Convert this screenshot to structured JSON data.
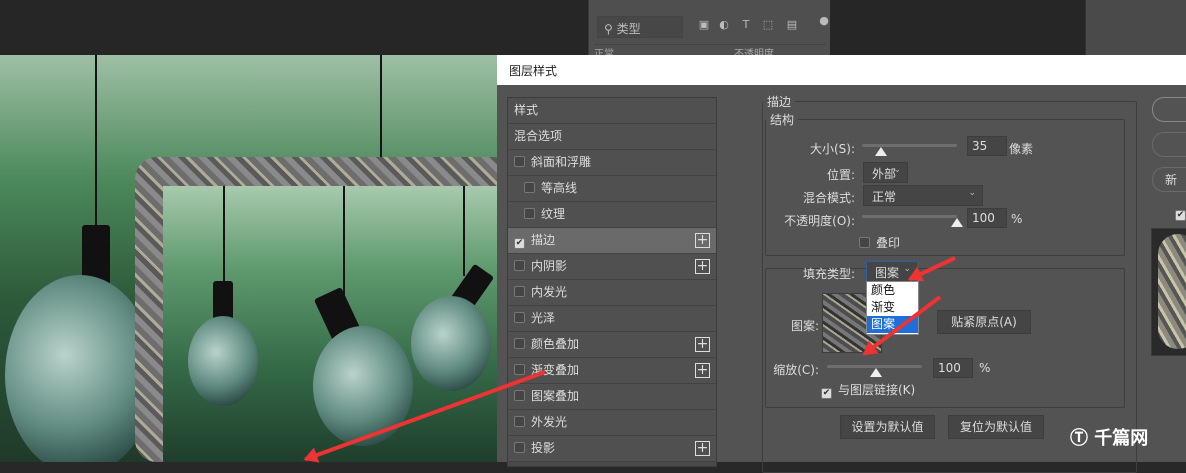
{
  "layers_panel": {
    "search_placeholder": "类型",
    "filter_icons": [
      "image-filter-icon",
      "adjustment-filter-icon",
      "type-filter-icon",
      "shape-filter-icon",
      "smart-object-filter-icon"
    ],
    "blend_mode": "正常",
    "opacity_label": "不透明度"
  },
  "dialog": {
    "title": "图层样式",
    "styles": [
      {
        "label": "样式",
        "checkbox": false
      },
      {
        "label": "混合选项",
        "checkbox": false
      },
      {
        "label": "斜面和浮雕",
        "checkbox": true,
        "checked": false
      },
      {
        "label": "等高线",
        "checkbox": true,
        "checked": false,
        "indent": true
      },
      {
        "label": "纹理",
        "checkbox": true,
        "checked": false,
        "indent": true
      },
      {
        "label": "描边",
        "checkbox": true,
        "checked": true,
        "plus": true,
        "active": true
      },
      {
        "label": "内阴影",
        "checkbox": true,
        "checked": false,
        "plus": true
      },
      {
        "label": "内发光",
        "checkbox": true,
        "checked": false
      },
      {
        "label": "光泽",
        "checkbox": true,
        "checked": false
      },
      {
        "label": "颜色叠加",
        "checkbox": true,
        "checked": false,
        "plus": true
      },
      {
        "label": "渐变叠加",
        "checkbox": true,
        "checked": false,
        "plus": true
      },
      {
        "label": "图案叠加",
        "checkbox": true,
        "checked": false
      },
      {
        "label": "外发光",
        "checkbox": true,
        "checked": false
      },
      {
        "label": "投影",
        "checkbox": true,
        "checked": false,
        "plus": true
      }
    ],
    "stroke": {
      "section_title": "描边",
      "structure_title": "结构",
      "size_label": "大小(S):",
      "size_value": "35",
      "size_unit": "像素",
      "size_slider_fraction": 0.2,
      "position_label": "位置:",
      "position_value": "外部",
      "blend_label": "混合模式:",
      "blend_value": "正常",
      "opacity_label": "不透明度(O):",
      "opacity_value": "100",
      "opacity_unit": "%",
      "overprint_label": "叠印",
      "overprint_checked": false,
      "fill_type_label": "填充类型:",
      "fill_type_value": "图案",
      "fill_type_options": [
        "颜色",
        "渐变",
        "图案"
      ],
      "pattern_label": "图案:",
      "snap_origin_button": "贴紧原点(A)",
      "scale_label": "缩放(C):",
      "scale_value": "100",
      "scale_unit": "%",
      "link_label": "与图层链接(K)",
      "link_checked": true,
      "set_default_button": "设置为默认值",
      "reset_default_button": "复位为默认值"
    },
    "side_buttons": [
      "",
      "",
      "新"
    ],
    "preview_checked": true
  },
  "watermark": "千篇网",
  "colors": {
    "arrow": "#e33333",
    "highlight": "#1e6fd9"
  }
}
